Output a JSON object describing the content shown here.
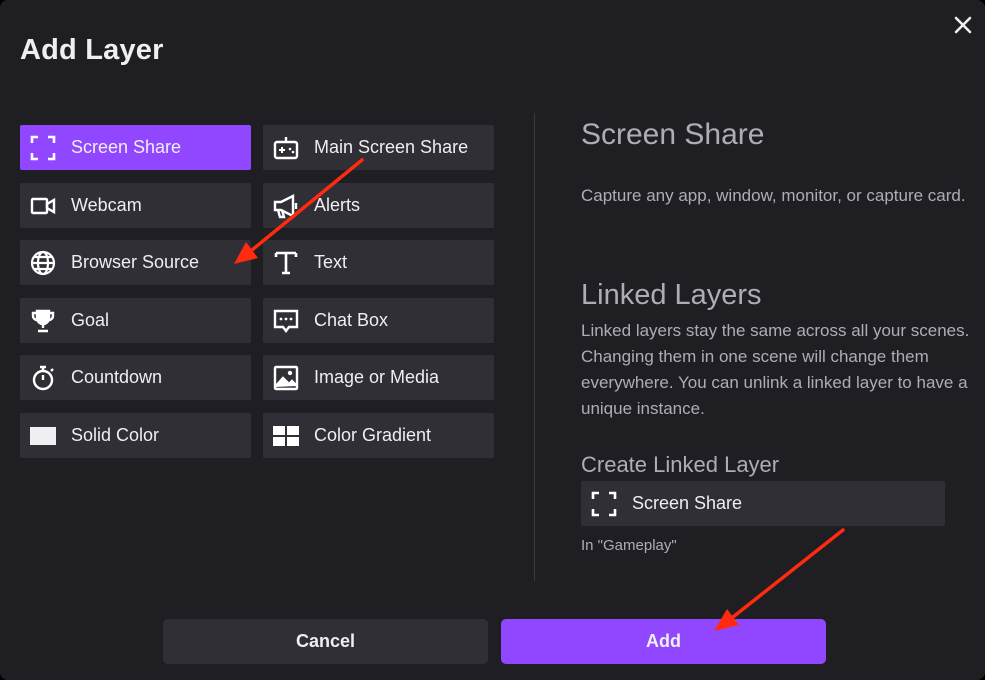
{
  "dialog": {
    "title": "Add Layer"
  },
  "layers": {
    "col1": [
      {
        "label": "Screen Share",
        "icon": "screen-share-icon",
        "active": true
      },
      {
        "label": "Webcam",
        "icon": "webcam-icon"
      },
      {
        "label": "Browser Source",
        "icon": "globe-icon"
      },
      {
        "label": "Goal",
        "icon": "trophy-icon"
      },
      {
        "label": "Countdown",
        "icon": "stopwatch-icon"
      },
      {
        "label": "Solid Color",
        "icon": "solid-color-icon"
      }
    ],
    "col2": [
      {
        "label": "Main Screen Share",
        "icon": "gamepad-icon"
      },
      {
        "label": "Alerts",
        "icon": "megaphone-icon"
      },
      {
        "label": "Text",
        "icon": "text-icon"
      },
      {
        "label": "Chat Box",
        "icon": "chat-icon"
      },
      {
        "label": "Image or Media",
        "icon": "image-icon"
      },
      {
        "label": "Color Gradient",
        "icon": "gradient-icon"
      }
    ]
  },
  "details": {
    "title": "Screen Share",
    "description": "Capture any app, window, monitor, or capture card.",
    "linked_title": "Linked Layers",
    "linked_description": "Linked layers stay the same across all your scenes. Changing them in one scene will change them everywhere. You can unlink a linked layer to have a unique instance.",
    "create_title": "Create Linked Layer",
    "linked_item_label": "Screen Share",
    "scene_label": "In \"Gameplay\""
  },
  "footer": {
    "cancel_label": "Cancel",
    "add_label": "Add"
  },
  "colors": {
    "accent": "#9147ff",
    "annotation_arrow": "#ff2a0f",
    "background": "#1f1f23",
    "tile": "#2f2f35"
  }
}
